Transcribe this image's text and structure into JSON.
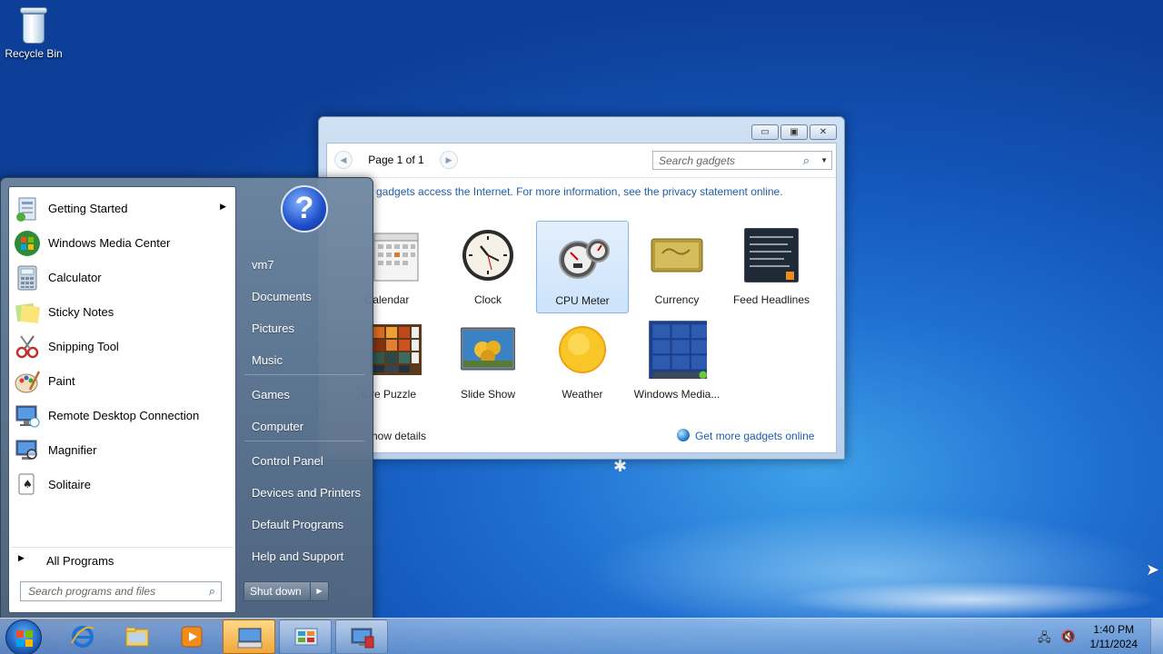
{
  "desktop": {
    "icons": [
      {
        "label": "Recycle Bin",
        "icon": "recycle-bin-icon"
      }
    ]
  },
  "gadget_window": {
    "controls": {
      "minimize": "▭",
      "maximize": "▣",
      "close": "✕"
    },
    "pager": {
      "prev": "◀",
      "text": "Page 1 of 1",
      "next": "▶"
    },
    "search": {
      "placeholder": "Search gadgets",
      "icon": "search-icon",
      "dropdown": "▼"
    },
    "info": "gadgets access the Internet.  For more information, see the privacy statement online.",
    "gadgets": [
      {
        "label": "Calendar",
        "icon": "calendar-icon"
      },
      {
        "label": "Clock",
        "icon": "clock-icon"
      },
      {
        "label": "CPU Meter",
        "icon": "cpu-meter-icon",
        "selected": true
      },
      {
        "label": "Currency",
        "icon": "currency-icon"
      },
      {
        "label": "Feed Headlines",
        "icon": "feed-headlines-icon"
      },
      {
        "label": "ture Puzzle",
        "icon": "picture-puzzle-icon"
      },
      {
        "label": "Slide Show",
        "icon": "slide-show-icon"
      },
      {
        "label": "Weather",
        "icon": "weather-icon"
      },
      {
        "label": "Windows Media...",
        "icon": "windows-media-center-icon"
      }
    ],
    "footer": {
      "show_details": "how details",
      "more_online": "Get more gadgets online"
    }
  },
  "start_menu": {
    "programs": [
      {
        "label": "Getting Started",
        "icon": "getting-started-icon",
        "has_submenu": true,
        "submenu_arrow": "▶"
      },
      {
        "label": "Windows Media Center",
        "icon": "windows-media-center-icon"
      },
      {
        "label": "Calculator",
        "icon": "calculator-icon"
      },
      {
        "label": "Sticky Notes",
        "icon": "sticky-notes-icon"
      },
      {
        "label": "Snipping Tool",
        "icon": "snipping-tool-icon"
      },
      {
        "label": "Paint",
        "icon": "paint-icon"
      },
      {
        "label": "Remote Desktop Connection",
        "icon": "remote-desktop-icon"
      },
      {
        "label": "Magnifier",
        "icon": "magnifier-icon"
      },
      {
        "label": "Solitaire",
        "icon": "solitaire-icon"
      }
    ],
    "all_programs": {
      "label": "All Programs",
      "arrow": "▶"
    },
    "search": {
      "placeholder": "Search programs and files",
      "icon": "search-icon"
    },
    "right_items": [
      "vm7",
      "Documents",
      "Pictures",
      "Music",
      "Games",
      "Computer",
      "Control Panel",
      "Devices and Printers",
      "Default Programs",
      "Help and Support"
    ],
    "help_glyph": "?",
    "shutdown": {
      "label": "Shut down",
      "arrow": "▶"
    }
  },
  "taskbar": {
    "pinned": [
      {
        "name": "internet-explorer",
        "icon": "internet-explorer-icon"
      },
      {
        "name": "windows-explorer",
        "icon": "folder-icon"
      },
      {
        "name": "media-player",
        "icon": "media-player-icon"
      },
      {
        "name": "on-screen-keyboard",
        "icon": "keyboard-icon",
        "state": "active"
      },
      {
        "name": "control-panel",
        "icon": "control-panel-icon",
        "state": "open"
      },
      {
        "name": "remote-desktop",
        "icon": "remote-desktop-icon",
        "state": "open"
      }
    ],
    "tray": {
      "network_icon": "network-icon",
      "volume_icon": "volume-muted-icon",
      "time": "1:40 PM",
      "date": "1/11/2024"
    }
  }
}
